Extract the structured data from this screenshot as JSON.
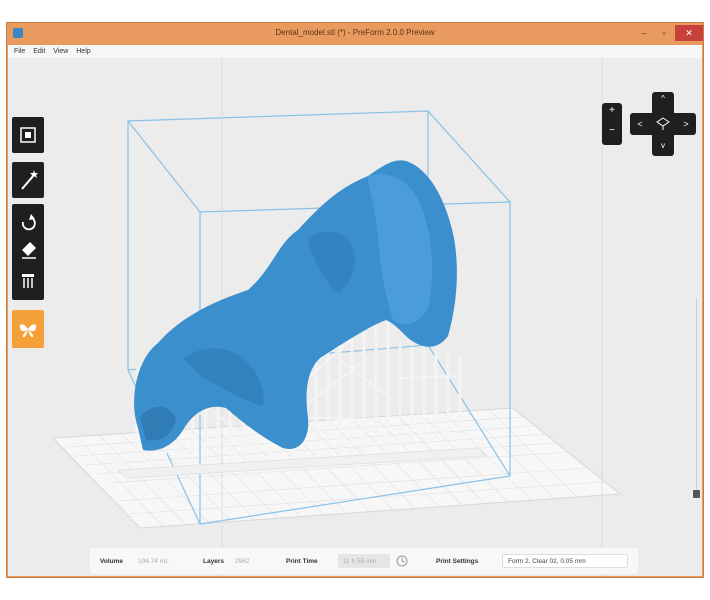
{
  "window": {
    "title": "Dental_model.stl (*) - PreForm 2.0.0 Preview",
    "min_glyph": "–",
    "max_glyph": "▫",
    "close_glyph": "✕"
  },
  "menu": {
    "items": [
      "File",
      "Edit",
      "View",
      "Help"
    ]
  },
  "toolbar": {
    "tools": [
      "layout-icon",
      "magic-wand-icon",
      "rotate-icon",
      "eraser-icon",
      "supports-icon",
      "butterfly-icon"
    ],
    "active_color": "#f6a03a"
  },
  "zoom": {
    "in": "+",
    "out": "−"
  },
  "nav": {
    "up": "^",
    "down": "v",
    "left": "<",
    "right": ">"
  },
  "status": {
    "volume_label": "Volume",
    "volume_value": "104.74 mL",
    "layers_label": "Layers",
    "layers_value": "2962",
    "print_time_label": "Print Time",
    "print_time_value": "11 h 55 min",
    "print_settings_label": "Print Settings",
    "print_settings_value": "Form 2, Clear 02, 0.05 mm"
  },
  "colors": {
    "model": "#3b8fcd",
    "supports": "#f4f4f4",
    "box": "#88c1e8"
  }
}
